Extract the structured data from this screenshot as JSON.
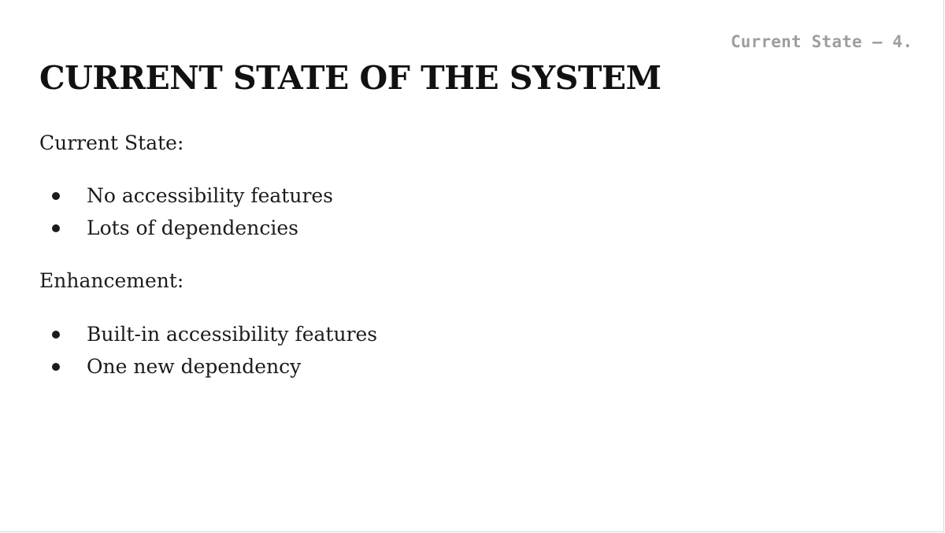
{
  "slide": {
    "section_label": "Current State — 4.",
    "title": "CURRENT STATE OF THE SYSTEM",
    "current_state": {
      "heading": "Current State:",
      "items": [
        "No accessibility features",
        "Lots of dependencies"
      ]
    },
    "enhancement": {
      "heading": "Enhancement:",
      "items": [
        "Built-in accessibility features",
        "One new dependency"
      ]
    }
  }
}
